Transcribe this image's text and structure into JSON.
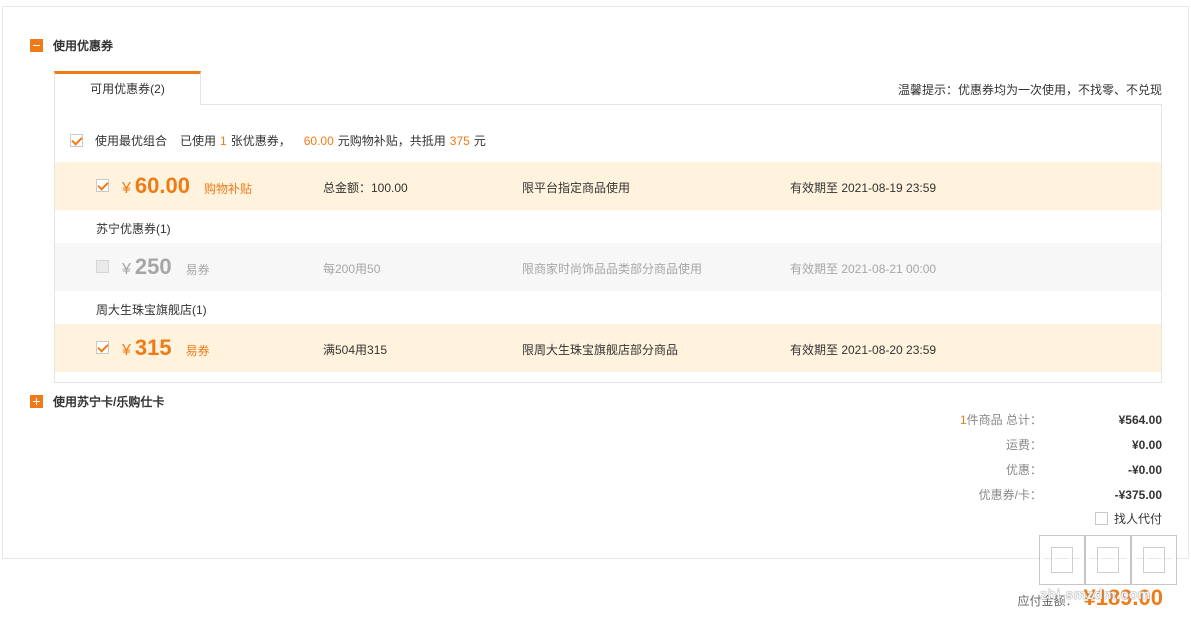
{
  "coupon_section": {
    "title": "使用优惠券"
  },
  "tab": {
    "label": "可用优惠券(2)"
  },
  "tip": "温馨提示：优惠券均为一次使用，不找零、不兑现",
  "best_combo": {
    "label": "使用最优组合",
    "used_prefix": "已使用",
    "used_count": "1",
    "used_unit": "张优惠券，",
    "subsidy_amount": "60.00",
    "subsidy_suffix": "元购物补贴，共抵用",
    "total_offset": "375",
    "total_unit": "元",
    "checked": true
  },
  "coupons": [
    {
      "symbol": "¥",
      "value": "60.00",
      "type": "购物补贴",
      "desc": "总金额：100.00",
      "limit": "限平台指定商品使用",
      "expire": "有效期至 2021-08-19 23:59",
      "checked": true,
      "enabled": true
    },
    {
      "symbol": "¥",
      "value": "250",
      "type": "易券",
      "desc": "每200用50",
      "limit": "限商家时尚饰品品类部分商品使用",
      "expire": "有效期至 2021-08-21 00:00",
      "checked": false,
      "enabled": false
    },
    {
      "symbol": "¥",
      "value": "315",
      "type": "易券",
      "desc": "满504用315",
      "limit": "限周大生珠宝旗舰店部分商品",
      "expire": "有效期至 2021-08-20 23:59",
      "checked": true,
      "enabled": true
    }
  ],
  "groups": [
    "苏宁优惠券(1)",
    "周大生珠宝旗舰店(1)"
  ],
  "card_section": {
    "title": "使用苏宁卡/乐购仕卡"
  },
  "summary": {
    "items_count": "1",
    "items_label": "件商品 总计：",
    "items_total": "¥564.00",
    "shipping_label": "运费：",
    "shipping": "¥0.00",
    "discount_label": "优惠：",
    "discount": "-¥0.00",
    "coupon_label": "优惠券/卡：",
    "coupon": "-¥375.00"
  },
  "proxy_pay": {
    "label": "找人代付",
    "checked": false
  },
  "payable": {
    "label": "应付金额：",
    "value": "¥189.00"
  },
  "watermark": {
    "glyph": "值",
    "text": "zhi.smzdm.com"
  },
  "colors": {
    "accent": "#f07b16",
    "active_row_bg": "#fff3de",
    "inactive_row_bg": "#f7f7f7",
    "disabled_text": "#a6a6a6"
  }
}
